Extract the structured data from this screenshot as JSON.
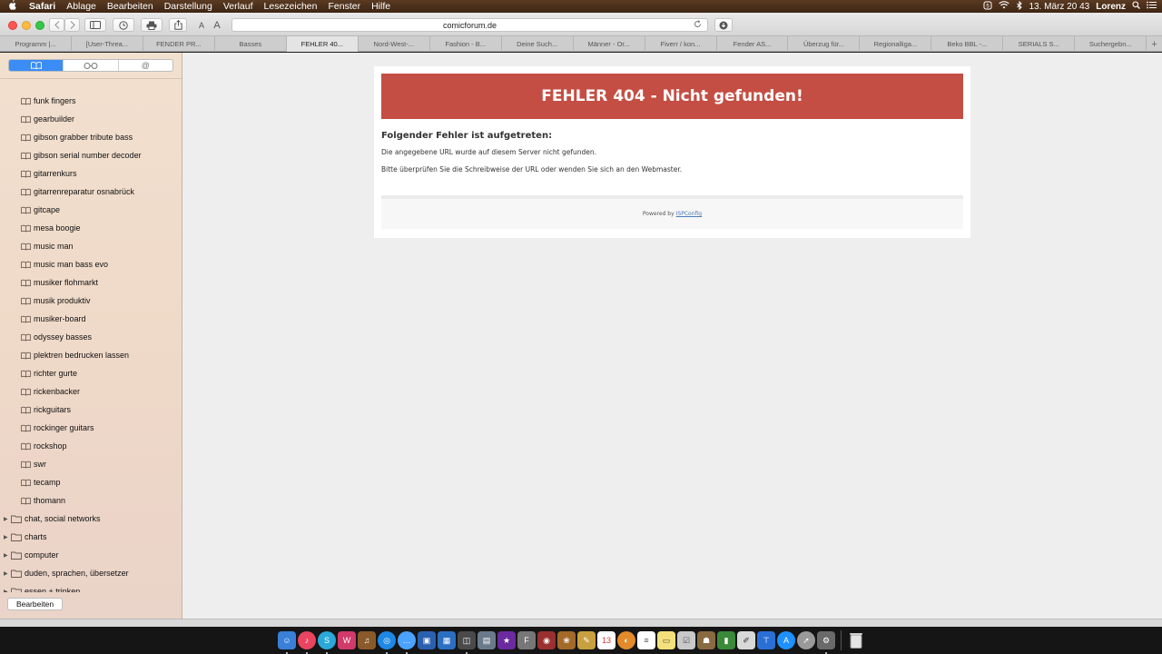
{
  "menubar": {
    "apple": "",
    "items": [
      "Safari",
      "Ablage",
      "Bearbeiten",
      "Darstellung",
      "Verlauf",
      "Lesezeichen",
      "Fenster",
      "Hilfe"
    ],
    "datetime": "13. März 20 43",
    "user": "Lorenz"
  },
  "toolbar": {
    "address": "comicforum.de",
    "font_small": "A",
    "font_large": "A"
  },
  "tabs": [
    {
      "label": "Programm |...",
      "active": false
    },
    {
      "label": "[User-Threa...",
      "active": false
    },
    {
      "label": "FENDER PR...",
      "active": false
    },
    {
      "label": "Basses",
      "active": false
    },
    {
      "label": "FEHLER 40...",
      "active": true
    },
    {
      "label": "Nord-West-...",
      "active": false
    },
    {
      "label": "Fashion - B...",
      "active": false
    },
    {
      "label": "Deine Such...",
      "active": false
    },
    {
      "label": "Männer - Or...",
      "active": false
    },
    {
      "label": "Fiverr / kon...",
      "active": false
    },
    {
      "label": "Fender AS...",
      "active": false
    },
    {
      "label": "Überzug für...",
      "active": false
    },
    {
      "label": "Regionalliga...",
      "active": false
    },
    {
      "label": "Beko BBL -...",
      "active": false
    },
    {
      "label": "SERIALS S...",
      "active": false
    },
    {
      "label": "Suchergebn...",
      "active": false
    }
  ],
  "tab_plus": "+",
  "sidebar": {
    "segments": [
      "bookmarks-icon",
      "reading-list-icon",
      "shared-links-icon"
    ],
    "shared_label": "@",
    "bookmarks": [
      "funk fingers",
      "gearbuilder",
      "gibson grabber tribute bass",
      "gibson serial number decoder",
      "gitarrenkurs",
      "gitarrenreparatur osnabrück",
      "gitcape",
      "mesa boogie",
      "music man",
      "music man bass evo",
      "musiker flohmarkt",
      "musik produktiv",
      "musiker-board",
      "odyssey basses",
      "plektren bedrucken lassen",
      "richter gurte",
      "rickenbacker",
      "rickguitars",
      "rockinger guitars",
      "rockshop",
      "swr",
      "tecamp",
      "thomann"
    ],
    "folders": [
      "chat, social networks",
      "charts",
      "computer",
      "duden, sprachen, übersetzer",
      "essen + trinken"
    ],
    "edit_label": "Bearbeiten"
  },
  "page": {
    "heading": "FEHLER 404 - Nicht gefunden!",
    "subheading": "Folgender Fehler ist aufgetreten:",
    "line1": "Die angegebene URL wurde auf diesem Server nicht gefunden.",
    "line2": "Bitte überprüfen Sie die Schreibweise der URL oder wenden Sie sich an den Webmaster.",
    "powered_by": "Powered by",
    "powered_link": "ISPConfig"
  },
  "colors": {
    "error_header": "#c44e43",
    "segment_active": "#3b8cf5"
  }
}
